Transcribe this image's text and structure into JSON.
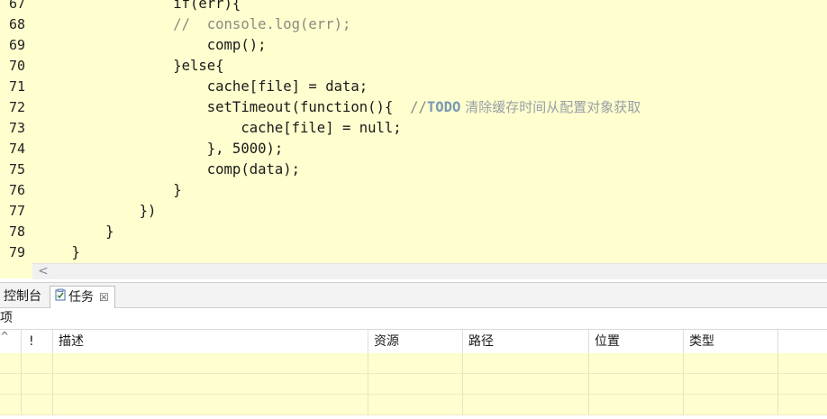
{
  "editor": {
    "lines": [
      {
        "num": "67",
        "text": "                if(err){"
      },
      {
        "num": "68",
        "text": "                //  console.log(err);"
      },
      {
        "num": "69",
        "text": "                    comp();"
      },
      {
        "num": "70",
        "text": "                }else{"
      },
      {
        "num": "71",
        "text": "                    cache[file] = data;"
      },
      {
        "num": "72",
        "text": "                    setTimeout(function(){  "
      },
      {
        "num": "73",
        "text": "                        cache[file] = null;"
      },
      {
        "num": "74",
        "text": "                    }, 5000);"
      },
      {
        "num": "75",
        "text": "                    comp(data);"
      },
      {
        "num": "76",
        "text": "                }"
      },
      {
        "num": "77",
        "text": "            })"
      },
      {
        "num": "78",
        "text": "        }"
      },
      {
        "num": "79",
        "text": "    }"
      }
    ],
    "todo_comment_prefix": "//",
    "todo_keyword": "TODO",
    "todo_text": " 清除缓存时间从配置对象获取",
    "scroll_left": "<"
  },
  "views": {
    "tab_console": "控制台",
    "tab_tasks": "任务",
    "tab_close": "☒",
    "count_label": "项"
  },
  "tasks_table": {
    "sort_indicator": "^",
    "columns": [
      "!",
      "描述",
      "资源",
      "路径",
      "位置",
      "类型"
    ],
    "rows": 3
  }
}
